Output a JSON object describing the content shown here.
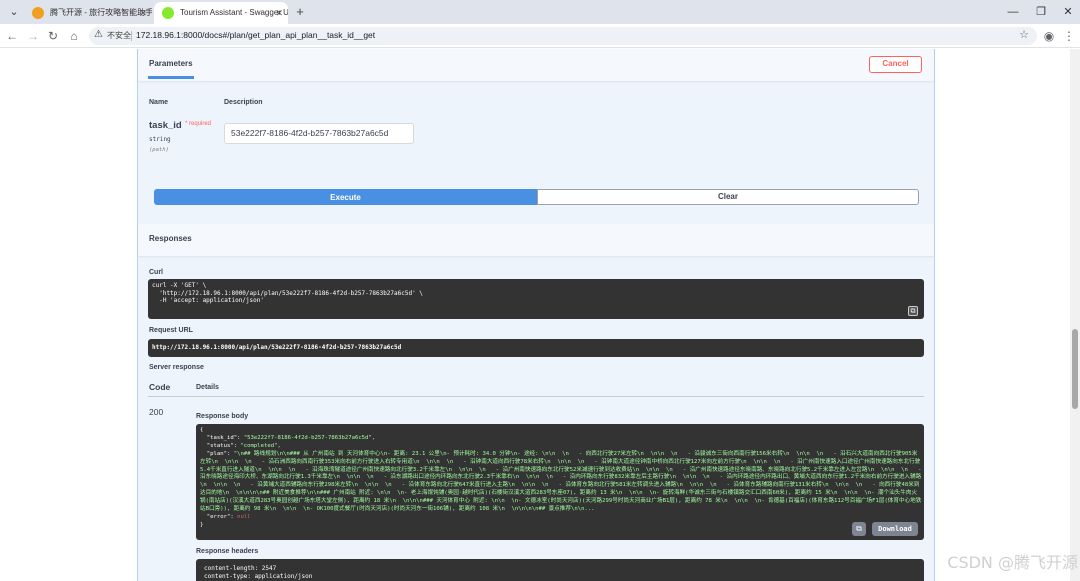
{
  "browser": {
    "tabs": [
      {
        "title": "腾飞开源 - 旅行攻略智能助手",
        "active": false
      },
      {
        "title": "Tourism Assistant - Swagger UI",
        "active": true
      }
    ],
    "new_tab": "+",
    "insecure_label": "不安全",
    "url": "172.18.96.1:8000/docs#/plan/get_plan_api_plan__task_id__get"
  },
  "parameters": {
    "title": "Parameters",
    "cancel_label": "Cancel",
    "col_name": "Name",
    "col_description": "Description",
    "param": {
      "name": "task_id",
      "required_mark": "* required",
      "type": "string",
      "in": "(path)",
      "value": "53e222f7-8186-4f2d-b257-7863b27a6c5d"
    },
    "execute_label": "Execute",
    "clear_label": "Clear"
  },
  "responses": {
    "title": "Responses",
    "curl_label": "Curl",
    "curl_text": "curl -X 'GET' \\\n  'http://172.18.96.1:8000/api/plan/53e222f7-8186-4f2d-b257-7863b27a6c5d' \\\n  -H 'accept: application/json'",
    "request_url_label": "Request URL",
    "request_url": "http://172.18.96.1:8000/api/plan/53e222f7-8186-4f2d-b257-7863b27a6c5d",
    "server_response_label": "Server response",
    "col_code": "Code",
    "col_details": "Details",
    "code": "200",
    "response_body_label": "Response body",
    "body": {
      "open": "{",
      "task_id_key": "\"task_id\":",
      "task_id_val": "\"53e222f7-8186-4f2d-b257-7863b27a6c5d\",",
      "status_key": "\"status\":",
      "status_val": "\"completed\",",
      "plan_key": "\"plan\":",
      "plan_val": "\"\\n## 路线规划\\n\\n### 从 广州南站 到 天河体育中心\\n- 距离: 23.1 公里\\n- 预计耗时: 34.0 分钟\\n- 途经: \\n\\n  \\n   - 向西北行驶27米左转\\n  \\n\\n  \\n   - 沿骏诚东三街向西南行驶156米右转\\n  \\n\\n  \\n   - 沿石兴大道南向西北行驶905米左转\\n  \\n\\n  \\n   - 沿石洲西路向西南行驶353米向右前方行驶进入右转专用道\\n  \\n\\n  \\n   - 沿钟南大道向西行驶78米右转\\n  \\n\\n  \\n   - 沿钟南大道途径钟南中桥向西北行驶127米向左前方行驶\\n  \\n\\n  \\n   - 沿广州南快速路入口途径广州南快速路向东北行驶5.4千米直行进入隧道\\n  \\n\\n  \\n   - 沿海珠湾隧道途径广州南快速路向北行驶3.2千米靠左\\n  \\n\\n  \\n   - 沿广州南快速路向东北行驶52米减速行驶到达收费站\\n  \\n\\n  \\n   - 沿广州南快速路途径东晓南路、东晓路向北行驶5.2千米靠左进入左岔路\\n  \\n\\n  \\n   - 沿东晓路途径海印大桥、东湖路向北行驶1.3千米靠左\\n  \\n\\n  \\n   - 沿东湖路出口途径内环路向东北行驶2.3千米靠右\\n  \\n\\n  \\n   - 沿内环路向东行驶832米靠左后主路行驶\\n  \\n\\n  \\n   - 沿内环路途径内环路出口、黄埔大道西向东行驶1.2千米向右前方行驶进入辅路\\n  \\n\\n  \\n   - 沿黄埔大道西辅路向东行驶298米左转\\n  \\n\\n  \\n   - 沿体育东路向北行驶647米直行进入主路\\n  \\n\\n  \\n   - 沿体育东路向北行驶581米左转调头进入辅路\\n  \\n\\n  \\n   - 沿体育东路辅路向南行驶131米右转\\n  \\n\\n  \\n   - 向西行驶48米到达目的地\\n  \\n\\n\\n\\n## 附近美食推荐\\n\\n### 广州南站 附近: \\n\\n  \\n- 老上海馄饨铺(奥园·越时代店)(石楼街汉溪大道西283号东座07), 距离约 13 米\\n  \\n\\n  \\n- 旋转海鲜(华诚东三街与石楼镇路交汇口西南60米), 距离约 15 米\\n  \\n\\n  \\n- 潮个汕头牛肉火锅(南站店)(汉溪大道西283号奥园创越广场东塔大堂左侧), 距离约 18 米\\n  \\n\\n\\n### 天河体育中心 附近: \\n\\n  \\n- 文德冰室(时尚天河店)(天河路299号时尚天河商业广场B1层), 距离约 78 米\\n  \\n\\n  \\n- 肯德基(百福店)(体育东路112号百福广场F1层(体育中心地铁站B口旁)), 距离约 98 米\\n  \\n\\n  \\n- OK100度式餐厅(时尚天河店)(时尚天河东一街106铺), 距离约 108 米\\n  \\n\\n\\n\\n## 景点推荐\\n\\n...",
      "error_key": "\"error\":",
      "error_val": "null",
      "close": "}"
    },
    "download_label": "Download",
    "response_headers_label": "Response headers",
    "headers": [
      "content-length: 2547",
      "content-type: application/json"
    ]
  },
  "watermark": "CSDN @腾飞开源"
}
